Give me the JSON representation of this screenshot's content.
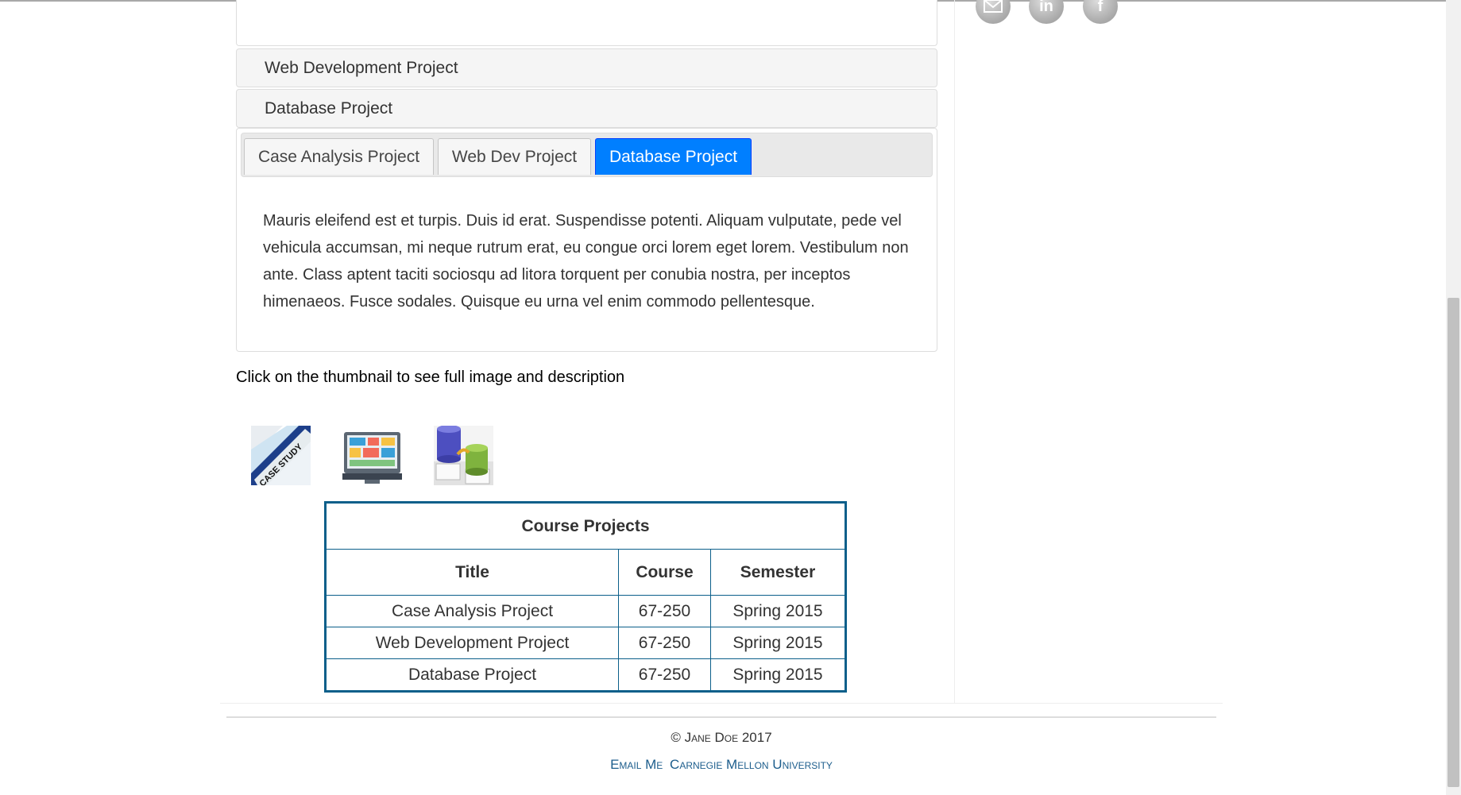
{
  "accordion": {
    "headings": [
      "Web Development Project",
      "Database Project"
    ]
  },
  "tabs": [
    "Case Analysis Project",
    "Web Dev Project",
    "Database Project"
  ],
  "active_tab_index": 2,
  "tab_body": "Mauris eleifend est et turpis. Duis id erat. Suspendisse potenti. Aliquam vulputate, pede vel vehicula accumsan, mi neque rutrum erat, eu congue orci lorem eget lorem. Vestibulum non ante. Class aptent taciti sociosqu ad litora torquent per conubia nostra, per inceptos himenaeos. Fusce sodales. Quisque eu urna vel enim commodo pellentesque.",
  "hint": "Click on the thumbnail to see full image and description",
  "thumbnails": [
    {
      "icon": "case-study-thumbnail",
      "label": "CASE STUDY"
    },
    {
      "icon": "web-dev-thumbnail"
    },
    {
      "icon": "database-thumbnail"
    }
  ],
  "table": {
    "caption": "Course Projects",
    "headers": [
      "Title",
      "Course",
      "Semester"
    ],
    "rows": [
      [
        "Case Analysis Project",
        "67-250",
        "Spring 2015"
      ],
      [
        "Web Development Project",
        "67-250",
        "Spring 2015"
      ],
      [
        "Database Project",
        "67-250",
        "Spring 2015"
      ]
    ]
  },
  "social": [
    {
      "icon": "email-icon"
    },
    {
      "icon": "linkedin-icon",
      "glyph": "in"
    },
    {
      "icon": "facebook-icon",
      "glyph": "f"
    }
  ],
  "footer": {
    "copyright": "© Jane Doe 2017",
    "links": [
      "Email Me",
      "Carnegie Mellon University"
    ]
  },
  "colors": {
    "active_tab": "#007fff",
    "table_border": "#0b5f8a",
    "footer_link": "#1c5d8c"
  }
}
